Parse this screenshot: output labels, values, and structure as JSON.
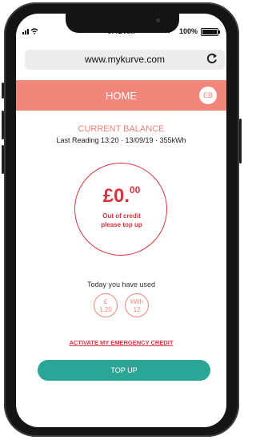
{
  "status_bar": {
    "time": "9:41 AM",
    "battery": "100%",
    "battery_level": 1.0
  },
  "browser": {
    "url": "www.mykurve.com"
  },
  "header": {
    "title": "HOME",
    "avatar_initials": "EB"
  },
  "balance": {
    "label": "CURRENT BALANCE",
    "last_reading": "Last Reading  13:20 · 13/09/19 · 355kWh",
    "amount_main": "£0.",
    "amount_pence": "00",
    "status_line1": "Out of credit",
    "status_line2": "please top up"
  },
  "usage": {
    "label": "Today you have used",
    "money": {
      "unit": "£",
      "value": "1.20"
    },
    "energy": {
      "unit": "kWh",
      "value": "12"
    }
  },
  "emergency_link": "ACTIVATE MY EMERGENCY CREDIT",
  "topup_button": "TOP UP",
  "colors": {
    "brand": "#f2867a",
    "alert": "#e0303f",
    "action": "#2ba596"
  }
}
